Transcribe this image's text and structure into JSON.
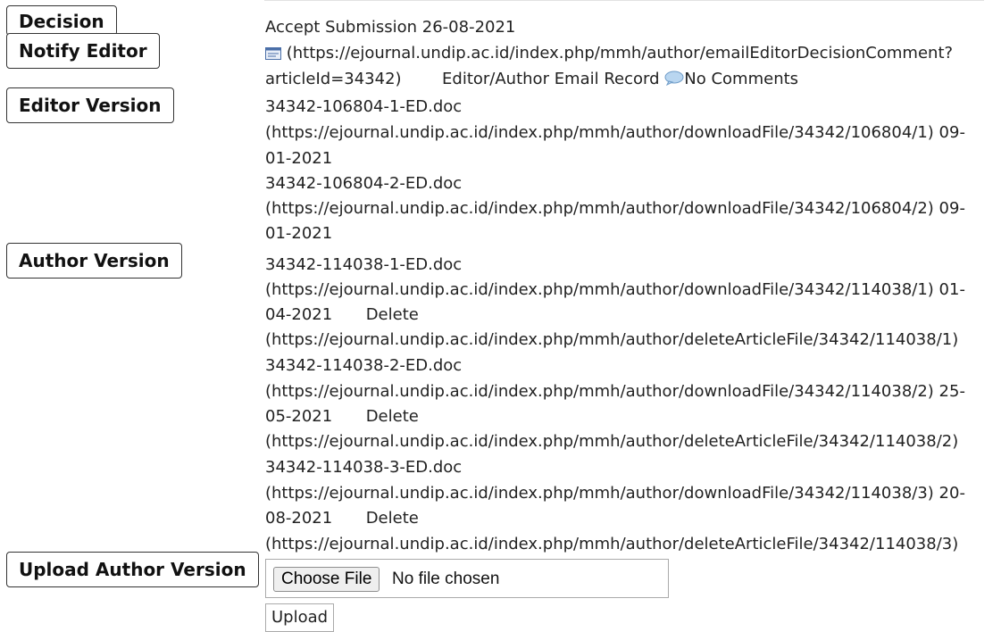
{
  "labels": {
    "decision": "Decision",
    "notify_editor": "Notify Editor",
    "editor_version": "Editor Version",
    "author_version": "Author Version",
    "upload_author_version": "Upload Author Version"
  },
  "decision": {
    "text": "Accept Submission 26-08-2021"
  },
  "notify": {
    "link_line1": "(https://ejournal.undip.ac.id/index.php/mmh/author/emailEditorDecisionComment?",
    "link_line2": "articleId=34342)",
    "email_record": "Editor/Author Email Record",
    "comments": "No Comments",
    "icons": [
      "email-icon",
      "comment-bubble-icon"
    ]
  },
  "editor_files": [
    {
      "name": "34342-106804-1-ED.doc",
      "url_line": "(https://ejournal.undip.ac.id/index.php/mmh/author/downloadFile/34342/106804/1)  09-",
      "date_tail": "01-2021"
    },
    {
      "name": "34342-106804-2-ED.doc",
      "url_line": "(https://ejournal.undip.ac.id/index.php/mmh/author/downloadFile/34342/106804/2)  09-",
      "date_tail": "01-2021"
    }
  ],
  "author_files": [
    {
      "name": "34342-114038-1-ED.doc",
      "url_line": "(https://ejournal.undip.ac.id/index.php/mmh/author/downloadFile/34342/114038/1)  01-",
      "date_tail": "04-2021",
      "delete_label": "Delete",
      "delete_url": "(https://ejournal.undip.ac.id/index.php/mmh/author/deleteArticleFile/34342/114038/1)"
    },
    {
      "name": "34342-114038-2-ED.doc",
      "url_line": "(https://ejournal.undip.ac.id/index.php/mmh/author/downloadFile/34342/114038/2)  25-",
      "date_tail": "05-2021",
      "delete_label": "Delete",
      "delete_url": "(https://ejournal.undip.ac.id/index.php/mmh/author/deleteArticleFile/34342/114038/2)"
    },
    {
      "name": "34342-114038-3-ED.doc",
      "url_line": "(https://ejournal.undip.ac.id/index.php/mmh/author/downloadFile/34342/114038/3)  20-",
      "date_tail": "08-2021",
      "delete_label": "Delete",
      "delete_url": "(https://ejournal.undip.ac.id/index.php/mmh/author/deleteArticleFile/34342/114038/3)"
    }
  ],
  "upload_form": {
    "choose_file_label": "Choose File",
    "no_file_text": "No file chosen",
    "upload_button": "Upload"
  }
}
